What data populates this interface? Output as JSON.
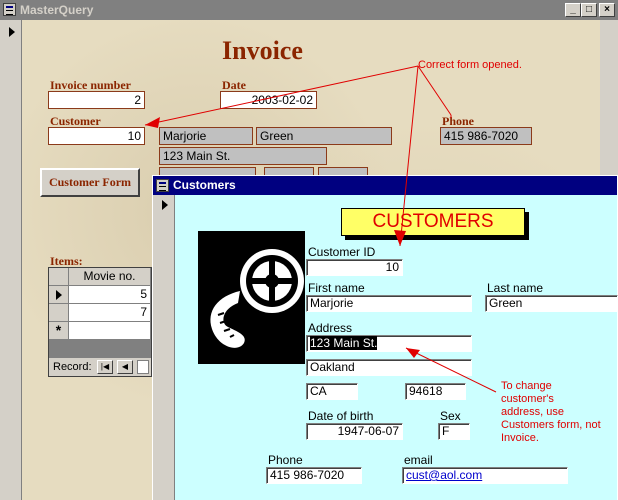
{
  "back_window": {
    "title": "MasterQuery",
    "form_title": "Invoice",
    "labels": {
      "invoice_number": "Invoice number",
      "date": "Date",
      "customer": "Customer",
      "phone": "Phone",
      "items": "Items:"
    },
    "values": {
      "invoice_number": "2",
      "date": "2003-02-02",
      "customer_id": "10",
      "first_name": "Marjorie",
      "last_name": "Green",
      "address": "123 Main St.",
      "phone": "415 986-7020"
    },
    "customer_form_button": "Customer Form",
    "items_grid": {
      "column_header": "Movie no.",
      "rows": [
        "5",
        "7"
      ],
      "record_label": "Record:"
    }
  },
  "front_window": {
    "title": "Customers",
    "banner": "CUSTOMERS",
    "labels": {
      "customer_id": "Customer ID",
      "first_name": "First name",
      "last_name": "Last name",
      "address": "Address",
      "date_of_birth": "Date of birth",
      "sex": "Sex",
      "phone": "Phone",
      "email": "email"
    },
    "values": {
      "customer_id": "10",
      "first_name": "Marjorie",
      "last_name": "Green",
      "address1": "123 Main St.",
      "city": "Oakland",
      "state": "CA",
      "zip": "94618",
      "date_of_birth": "1947-06-07",
      "sex": "F",
      "phone": "415 986-7020",
      "email": "cust@aol.com"
    }
  },
  "annotations": {
    "correct_form": "Correct form opened.",
    "change_address": [
      "To change",
      "customer's",
      "address, use",
      "Customers form, not",
      "Invoice."
    ]
  },
  "colors": {
    "annotation_red": "#e00000",
    "banner_bg": "#ffff66",
    "form_bg": "#ccffff",
    "brown_label": "#8b2500",
    "title_active": "#000080"
  }
}
